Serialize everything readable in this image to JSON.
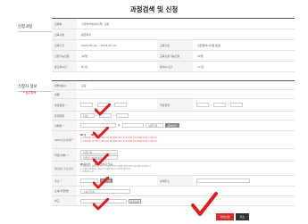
{
  "page_title": "과정검색 및 신청",
  "section_course": {
    "title": "신청과정"
  },
  "section_applicant": {
    "title": "신청자 정보",
    "required_note": "* 필수항목"
  },
  "course_info": {
    "rows": [
      {
        "label": "교육명",
        "value": "구급처치법(비수학) 교육",
        "label2": "",
        "value2": ""
      },
      {
        "label": "교육구분",
        "value": "응급처치",
        "label2": "",
        "value2": ""
      },
      {
        "label": "교육기간",
        "value": "2024.03.14 ~ 2024.03.14",
        "label2": "교육기관",
        "value2": "인천광역시지원 본원"
      },
      {
        "label": "신청가능인원",
        "value": "30명",
        "label2": "교육신청가능인원",
        "value2": "30명"
      },
      {
        "label": "총교육시간",
        "value": "8시간",
        "label2": "총이수시간",
        "value2": "1시간"
      }
    ]
  },
  "applicant_form": {
    "name_label": "성명(필수)",
    "name_value": "홍길",
    "gender_label": "성별",
    "birth_label": "생년월일",
    "birth_required": "*",
    "phone_label": "휴대전화",
    "phone_placeholder": "선택",
    "company_phone_label": "직장전화",
    "email_label": "이메일",
    "email_required": "*",
    "email_at": "@",
    "email_domain_select": "직접입력",
    "email_check_button": "중복확인",
    "sms_label": "SMS수신동의여부",
    "sms_required": "*",
    "sms_agree": "예",
    "sms_disagree": "아니오",
    "sms_note_1": "※ 수신동의를 하지 않으실 경우 교육 관련 알림 서비스 및 교육신청 결과 안내를 받으실 수 없습니다.",
    "sms_note_2": "※ 수신동의를 하지 않으실 경우 교육 관련 알림 서비스 및 교육신청 결과 안내를 받으실 수 없습니다.",
    "job_label": "직업(세부)",
    "job_required": "*",
    "job_select": "직업선택",
    "job_detail_select": "직업을 선택하세요",
    "agree_label": "개인정보 수집 동의",
    "agree_yes": "동의함",
    "agree_no": "동의하지 않음",
    "agree_note_1": "※ 개인정보 수집에 대해 동의 거부권이 있으며, 동의를 거부할 경우 교육신청이 불가합니다.",
    "agree_note_2": "※ 수집된 개인정보는 교육목적 이외의 용도로 사용되지 않습니다.",
    "agree_note_3": "※ 보유기간: 5년",
    "address_label": "주소",
    "address_required": "*",
    "address_search_button": "우편번호",
    "address_detail_label": "상세주소",
    "org_label": "소속(직장명)",
    "org_select": "소속을선택",
    "etc_label": "비고",
    "etc_button": "파일첨부"
  },
  "actions": {
    "apply": "과정신청",
    "cancel": "취소"
  },
  "colors": {
    "accent_red": "#d42a2a",
    "check_red": "#e01e1e",
    "dark": "#333333"
  }
}
